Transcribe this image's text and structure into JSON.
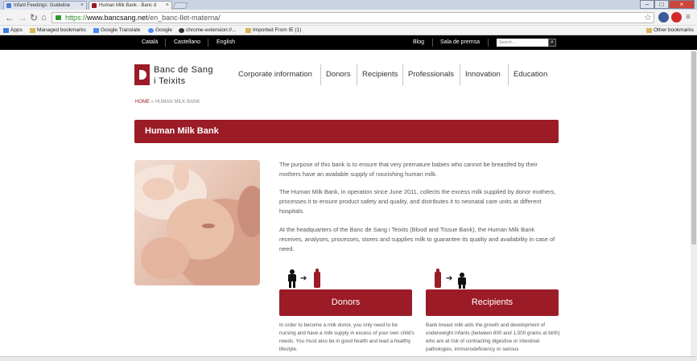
{
  "browser": {
    "tabs": [
      {
        "title": "Infant Feedings: Guideline"
      },
      {
        "title": "Human Milk Bank - Banc d"
      }
    ],
    "url_scheme": "https://",
    "url_host": "www.bancsang.net",
    "url_path": "/en_banc-llet-materna/",
    "bookmarks": [
      "Apps",
      "Managed bookmarks",
      "Google Translate",
      "Google",
      "chrome-extension://...",
      "Imported From IE (1)",
      "Other bookmarks"
    ]
  },
  "topbar": {
    "languages": [
      "Català",
      "Castellano",
      "English"
    ],
    "links": [
      "Blog",
      "Sala de premsa"
    ],
    "search_placeholder": "Search..."
  },
  "header": {
    "logo_line1": "Banc de Sang",
    "logo_line2": "i Teixits",
    "nav": [
      "Corporate information",
      "Donors",
      "Recipients",
      "Professionals",
      "Innovation",
      "Education"
    ]
  },
  "breadcrumb": {
    "home": "HOME",
    "sep": "»",
    "current": "HUMAN MILK BANK"
  },
  "page_title": "Human Milk Bank",
  "content": {
    "paragraphs": [
      "The purpose of this bank is to ensure that very premature babies who cannot be breastfed by their mothers have an available supply of nourishing human milk.",
      "The Human Milk Bank, in operation since June 2011, collects the excess milk supplied by donor mothers, processes it to ensure product safety and quality, and distributes it to neonatal care units at different hospitals.",
      "At the headquarters of the Banc de Sang i Teixits (Blood and Tissue Bank), the Human Milk Bank receives, analyses, processes, stores and supplies milk to guarantee its quality and availability in case of need."
    ]
  },
  "cards": [
    {
      "label": "Donors",
      "icon": "donor-to-bottle-icon",
      "text": "In order to become a milk donor, you only need to be nursing and have a milk supply in excess of your own child's needs. You must also be in good health and lead a healthy lifestyle."
    },
    {
      "label": "Recipients",
      "icon": "bottle-to-recipient-icon",
      "text": "Bank breast milk aids the growth and development of underweight infants (between 800 and 1,500 grams at birth) who are at risk of contracting digestive or intestinal pathologies, immunodeficiency or serious"
    }
  ],
  "colors": {
    "brand": "#9b1b26",
    "topbar": "#000000"
  }
}
